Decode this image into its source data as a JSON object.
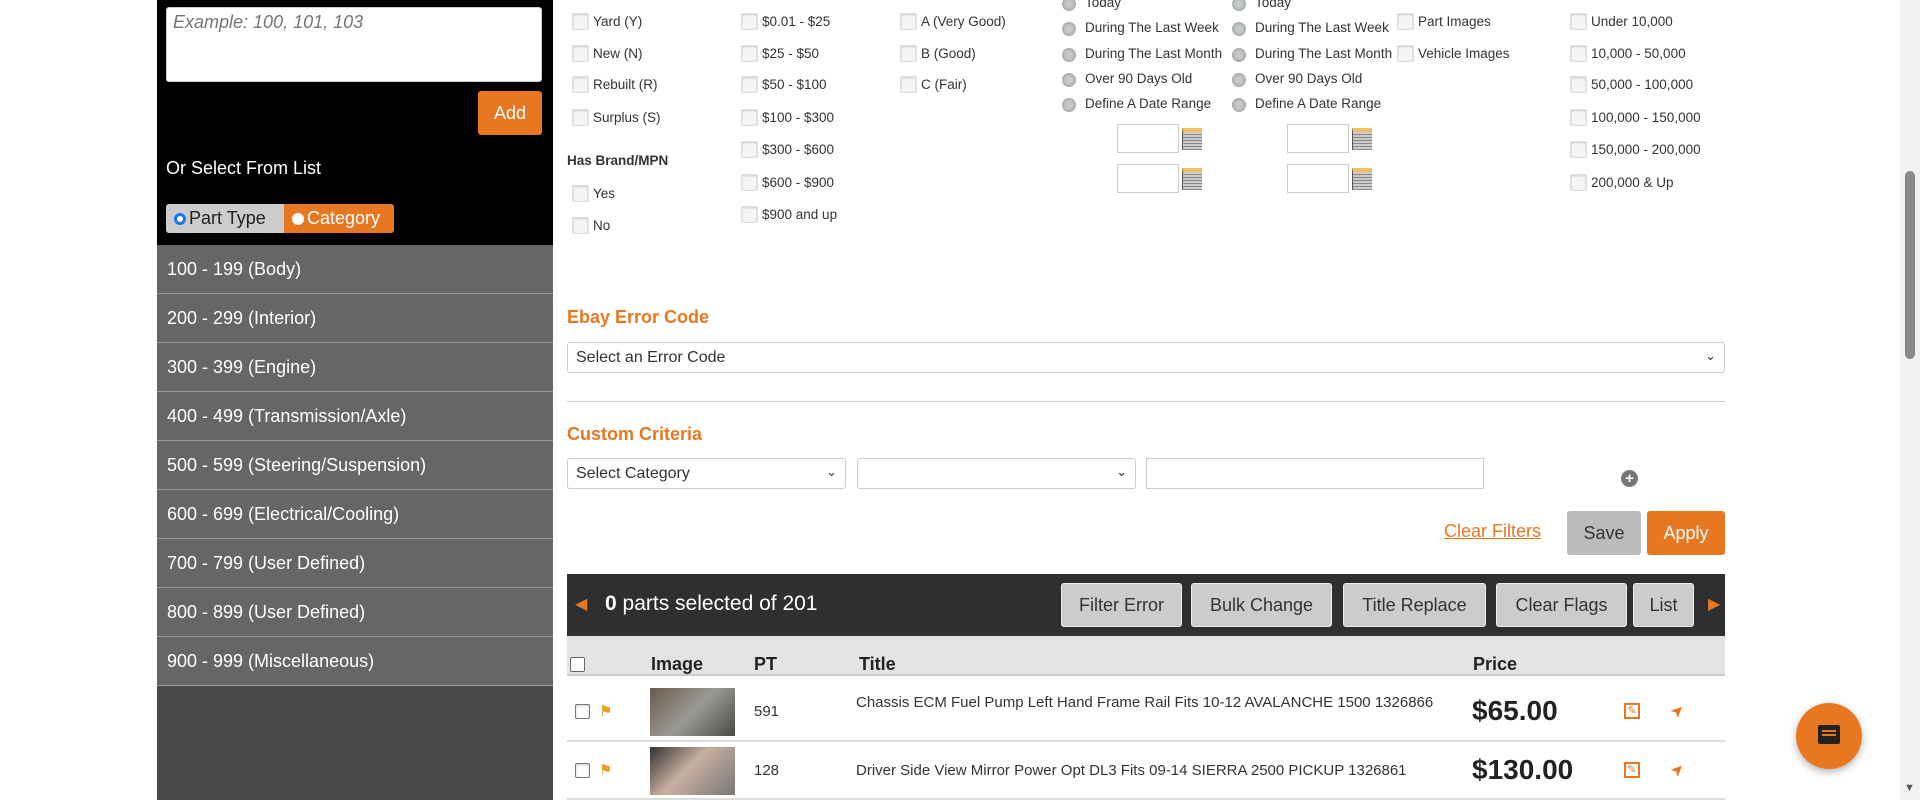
{
  "sidebar": {
    "id_placeholder": "Example: 100, 101, 103",
    "add_label": "Add",
    "or_select": "Or Select From List",
    "toggle": [
      "Part Type",
      "Category"
    ],
    "items": [
      "100 - 199 (Body)",
      "200 - 299 (Interior)",
      "300 - 399 (Engine)",
      "400 - 499 (Transmission/Axle)",
      "500 - 599 (Steering/Suspension)",
      "600 - 699 (Electrical/Cooling)",
      "700 - 799 (User Defined)",
      "800 - 899 (User Defined)",
      "900 - 999 (Miscellaneous)"
    ]
  },
  "filters": {
    "condition": [
      "Yard (Y)",
      "New (N)",
      "Rebuilt (R)",
      "Surplus (S)"
    ],
    "brand_heading": "Has Brand/MPN",
    "brand": [
      "Yes",
      "No"
    ],
    "price": [
      "$0.01 - $25",
      "$25 - $50",
      "$50 - $100",
      "$100 - $300",
      "$300 - $600",
      "$600 - $900",
      "$900 and up"
    ],
    "grade": [
      "A (Very Good)",
      "B (Good)",
      "C (Fair)"
    ],
    "date1": [
      "Today",
      "During The Last Week",
      "During The Last Month",
      "Over 90 Days Old",
      "Define A Date Range"
    ],
    "date2": [
      "Today",
      "During The Last Week",
      "During The Last Month",
      "Over 90 Days Old",
      "Define A Date Range"
    ],
    "images": [
      "Part Images",
      "Vehicle Images"
    ],
    "mileage": [
      "Under 10,000",
      "10,000 - 50,000",
      "50,000 - 100,000",
      "100,000 - 150,000",
      "150,000 - 200,000",
      "200,000 & Up"
    ]
  },
  "ebay": {
    "heading": "Ebay Error Code",
    "select": "Select an Error Code"
  },
  "custom": {
    "heading": "Custom Criteria",
    "select1": "Select Category",
    "select2": "",
    "input": ""
  },
  "actions": {
    "clear": "Clear Filters",
    "save": "Save",
    "apply": "Apply"
  },
  "toolbar": {
    "count": "0",
    "text": "parts selected of 201",
    "buttons": [
      "Filter Error",
      "Bulk Change",
      "Title Replace",
      "Clear Flags",
      "List"
    ]
  },
  "table": {
    "headers": [
      "Image",
      "PT",
      "Title",
      "Price"
    ],
    "rows": [
      {
        "pt": "591",
        "title": "Chassis ECM Fuel Pump Left Hand Frame Rail Fits 10-12 AVALANCHE 1500 1326866",
        "price": "$65.00"
      },
      {
        "pt": "128",
        "title": "Driver Side View Mirror Power Opt DL3 Fits 09-14 SIERRA 2500 PICKUP 1326861",
        "price": "$130.00"
      }
    ]
  },
  "colors": {
    "accent": "#e87722",
    "toolbar": "#2d2f31"
  }
}
